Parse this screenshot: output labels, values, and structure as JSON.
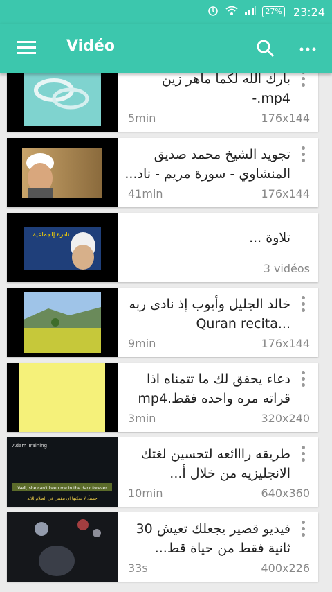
{
  "status_bar": {
    "battery": "27%",
    "time": "23:24"
  },
  "toolbar": {
    "title": "Vidéo"
  },
  "items": [
    {
      "title": "بارك الله لكما ماهر زين mp4.-",
      "duration": "5min",
      "resolution": "176x144"
    },
    {
      "title": "تجويد الشيخ محمد صديق المنشاوي - سورة مريم - ناد...",
      "duration": "41min",
      "resolution": "176x144"
    },
    {
      "title": "تلاوة ...",
      "duration": "",
      "resolution": "3 vidéos"
    },
    {
      "title": "خالد الجليل وأيوب إذ نادى ربه ...Quran recita",
      "duration": "9min",
      "resolution": "176x144"
    },
    {
      "title": "دعاء يحقق لك ما تتمناه اذا قراته مره واحده فقط.mp4",
      "duration": "3min",
      "resolution": "320x240"
    },
    {
      "title": "طريقه رااائعه لتحسين لغتك الانجليزيه من خلال أ...",
      "duration": "10min",
      "resolution": "640x360"
    },
    {
      "title": "فيديو قصير يجعلك تعيش 30 ثانية فقط من حياة قط...",
      "duration": "33s",
      "resolution": "400x226"
    }
  ],
  "thumb_texts": {
    "item2_banner": "نادرة إلجماعية",
    "item6_brand": "Adam Training",
    "item6_caption_en": "Well, she can't keep me in the dark forever",
    "item6_caption_ar": "حسناً، لا يمكنها ان تبقيني في الظلام للابد"
  }
}
